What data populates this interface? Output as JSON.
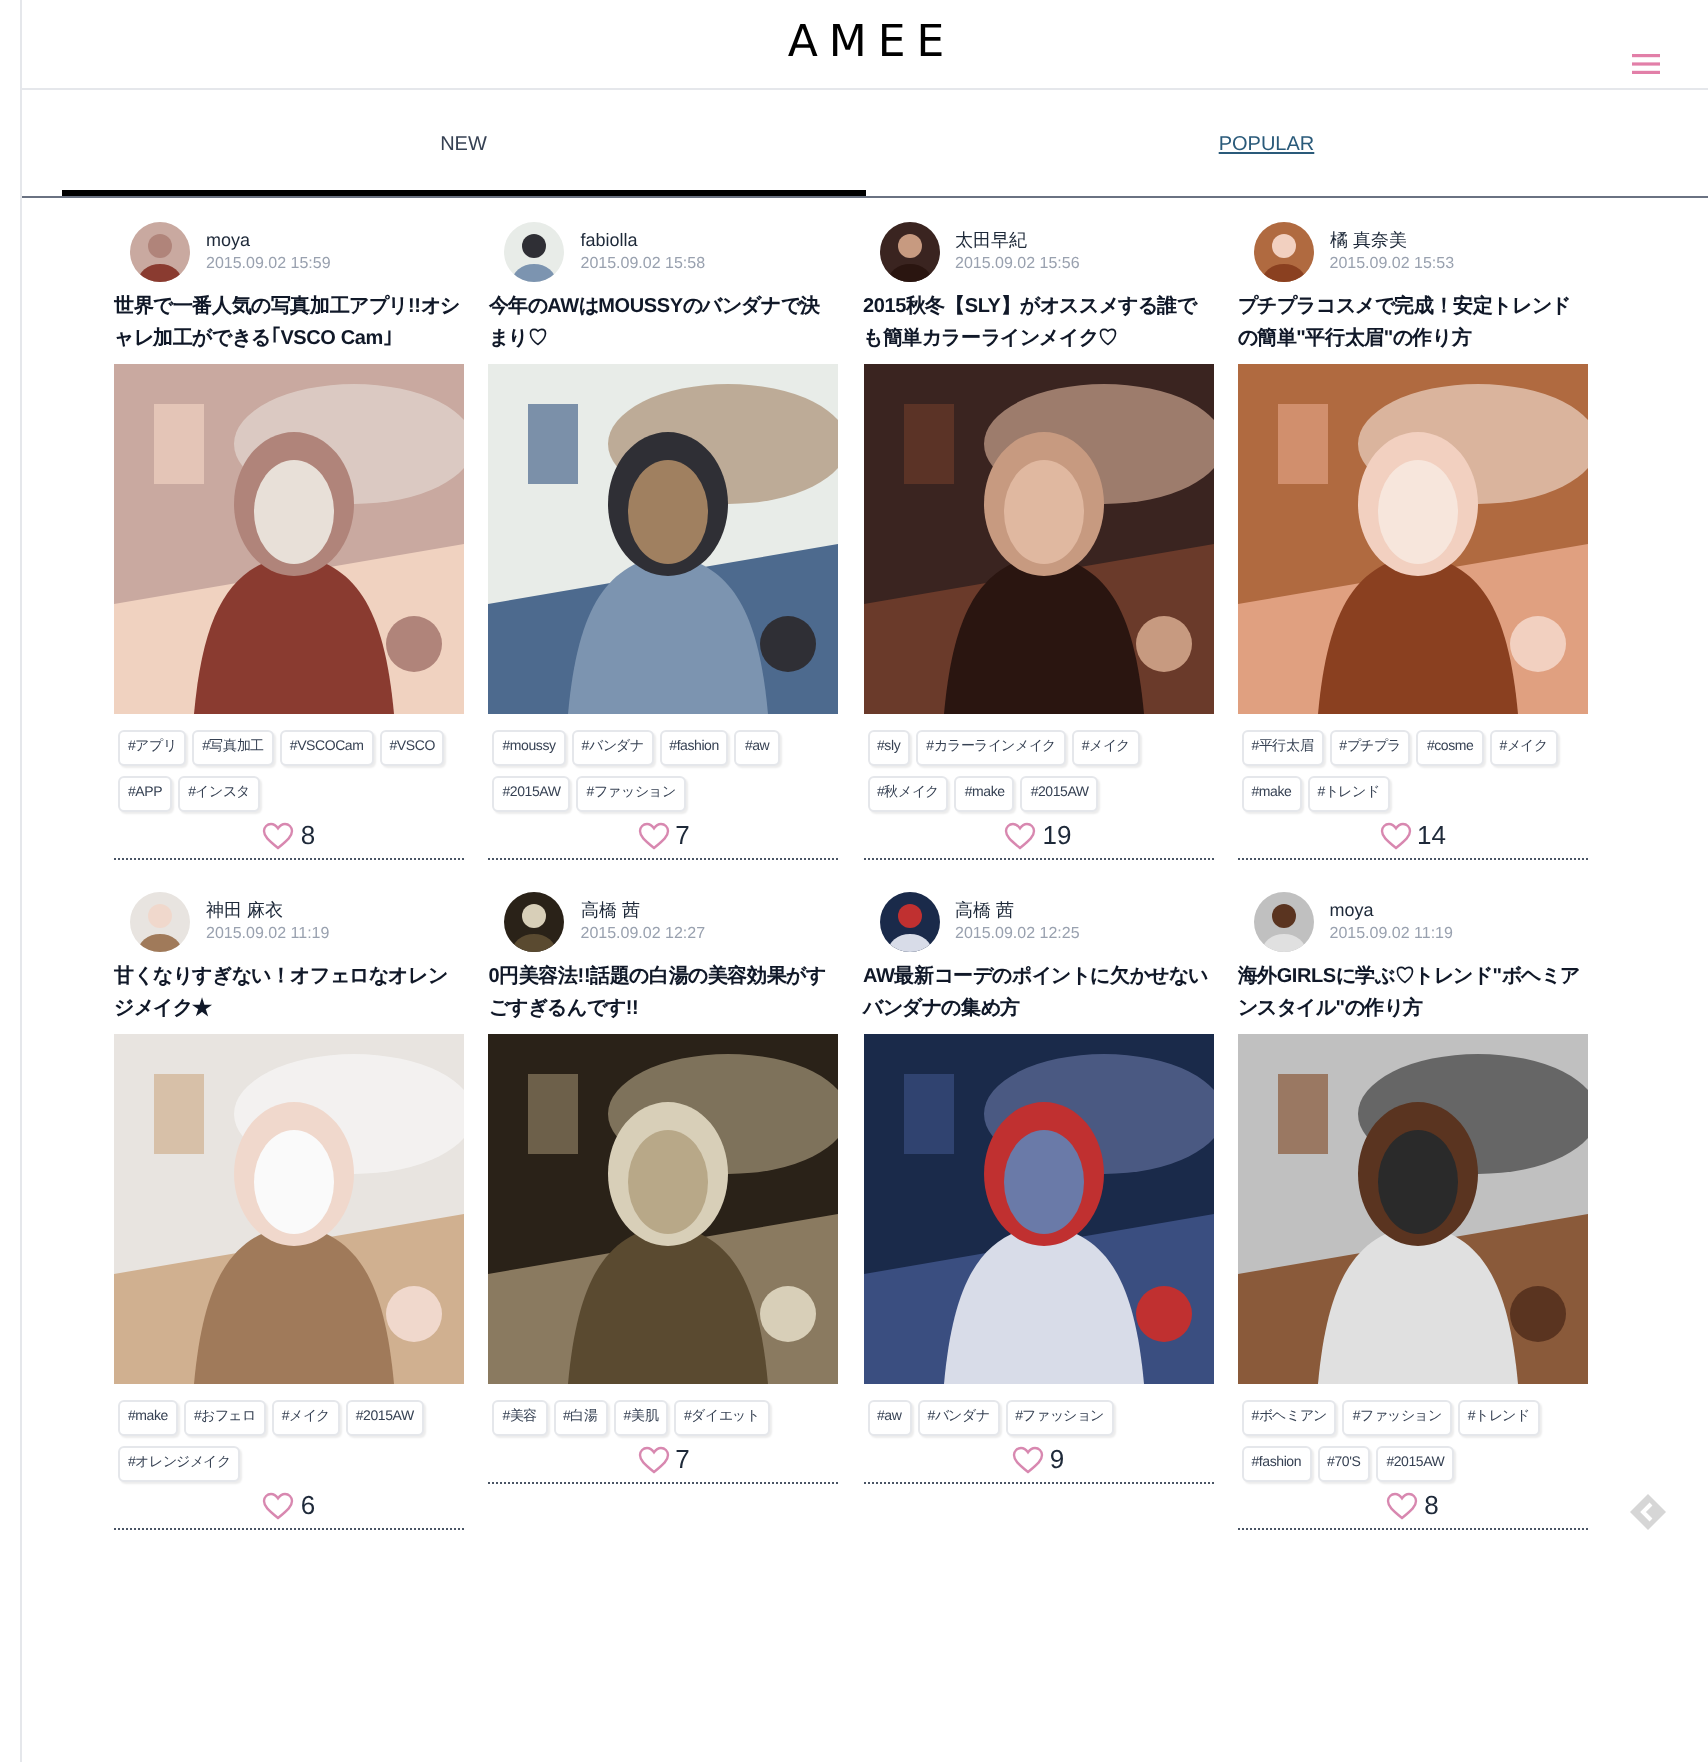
{
  "header": {
    "logo": "AMEE"
  },
  "tabs": [
    {
      "label": "NEW",
      "selected": true
    },
    {
      "label": "POPULAR",
      "selected": false
    }
  ],
  "articles": [
    {
      "author": "moya",
      "date": "2015.09.02 15:59",
      "title": "世界で一番人気の写真加工アプリ!!オシャレ加工ができる｢VSCO Cam｣",
      "tags": [
        "#アプリ",
        "#写真加工",
        "#VSCOCam",
        "#VSCO",
        "#APP",
        "#インスタ"
      ],
      "likes": "8"
    },
    {
      "author": "fabiolla",
      "date": "2015.09.02 15:58",
      "title": "今年のAWはMOUSSYのバンダナで決まり♡",
      "tags": [
        "#moussy",
        "#バンダナ",
        "#fashion",
        "#aw",
        "#2015AW",
        "#ファッション"
      ],
      "likes": "7"
    },
    {
      "author": "太田早紀",
      "date": "2015.09.02 15:56",
      "title": "2015秋冬【SLY】がオススメする誰でも簡単カラーラインメイク♡",
      "tags": [
        "#sly",
        "#カラーラインメイク",
        "#メイク",
        "#秋メイク",
        "#make",
        "#2015AW"
      ],
      "likes": "19"
    },
    {
      "author": "橘 真奈美",
      "date": "2015.09.02 15:53",
      "title": "プチプラコスメで完成！安定トレンドの簡単\"平行太眉\"の作り方",
      "tags": [
        "#平行太眉",
        "#プチプラ",
        "#cosme",
        "#メイク",
        "#make",
        "#トレンド"
      ],
      "likes": "14"
    },
    {
      "author": "神田 麻衣",
      "date": "2015.09.02 11:19",
      "title": "甘くなりすぎない！オフェロなオレンジメイク★",
      "tags": [
        "#make",
        "#おフェロ",
        "#メイク",
        "#2015AW",
        "#オレンジメイク"
      ],
      "likes": "6"
    },
    {
      "author": "高橋 茜",
      "date": "2015.09.02 12:27",
      "title": "0円美容法!!話題の白湯の美容効果がすごすぎるんです!!",
      "tags": [
        "#美容",
        "#白湯",
        "#美肌",
        "#ダイエット"
      ],
      "likes": "7"
    },
    {
      "author": "高橋 茜",
      "date": "2015.09.02 12:25",
      "title": "AW最新コーデのポイントに欠かせないバンダナの集め方",
      "tags": [
        "#aw",
        "#バンダナ",
        "#ファッション"
      ],
      "likes": "9"
    },
    {
      "author": "moya",
      "date": "2015.09.02 11:19",
      "title": "海外GIRLSに学ぶ♡トレンド\"ボヘミアンスタイル\"の作り方",
      "tags": [
        "#ボヘミアン",
        "#ファッション",
        "#トレンド",
        "#fashion",
        "#70'S",
        "#2015AW"
      ],
      "likes": "8"
    }
  ]
}
